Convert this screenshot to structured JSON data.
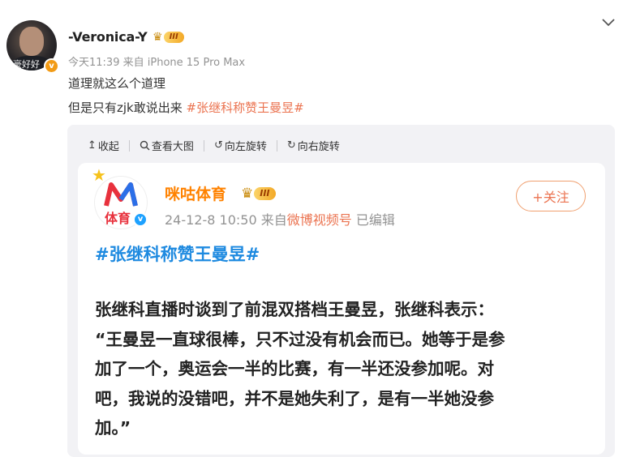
{
  "post": {
    "avatar_watermark": "豪好好",
    "user_name": "-Veronica-Y",
    "level_badge": "III",
    "time": "今天11:39",
    "source_prefix": "来自",
    "source": "iPhone 15 Pro Max",
    "text_line1": "道理就这么个道理",
    "text_line2_plain": "但是只有zjk敢说出来",
    "text_line2_tag": "#张继科称赞王曼昱#"
  },
  "toolbar": {
    "collapse": "收起",
    "view_large": "查看大图",
    "rotate_left": "向左旋转",
    "rotate_right": "向右旋转"
  },
  "card": {
    "logo_text": "体育",
    "name": "咪咕体育",
    "level_badge": "III",
    "date": "24-12-8 10:50",
    "source_prefix": "来自",
    "source": "微博视频号",
    "edited": "已编辑",
    "follow_label": "+关注",
    "hashtag": "#张继科称赞王曼昱#",
    "body_lines": [
      "张继科直播时谈到了前混双搭档王曼昱，张继科表示：",
      "“王曼昱一直球很棒，只不过没有机会而已。她等于是参",
      "加了一个，奥运会一半的比赛，有一半还没参加呢。对",
      "吧，我说的没错吧，并不是她失利了，是有一半她没参",
      "加。”"
    ]
  },
  "colors": {
    "accent_orange": "#eb7350",
    "card_name": "#ff8200",
    "hashtag_blue": "#1e8ae0"
  }
}
